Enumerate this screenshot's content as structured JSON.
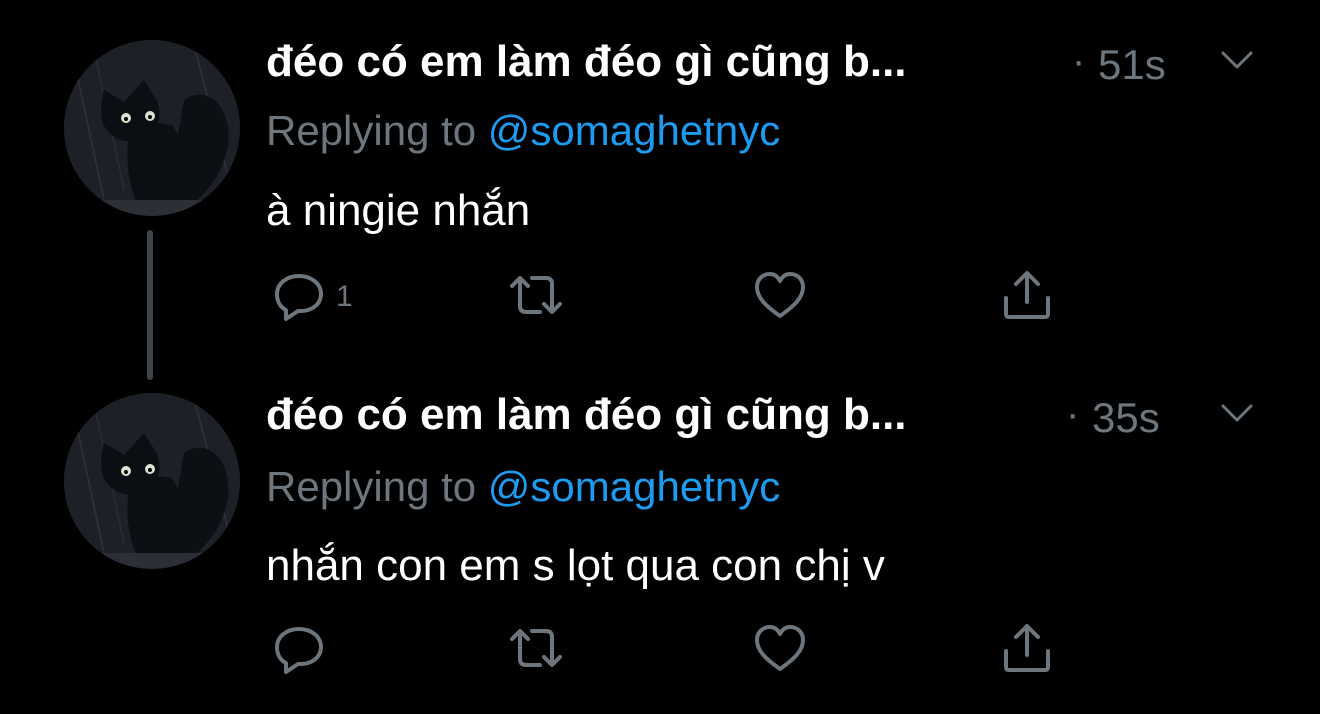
{
  "thread": {
    "tweets": [
      {
        "display_name": "đéo có em làm đéo gì cũng b...",
        "separator": "·",
        "time": "51s",
        "replying_prefix": "Replying to ",
        "replying_handle": "@somaghetnyc",
        "text": "à ningie nhắn",
        "reply_count": "1",
        "avatar_icon": "black-cat-avatar"
      },
      {
        "display_name": "đéo có em làm đéo gì cũng b...",
        "separator": "·",
        "time": "35s",
        "replying_prefix": "Replying to ",
        "replying_handle": "@somaghetnyc",
        "text": "nhắn con em s lọt qua con chị v",
        "reply_count": "",
        "avatar_icon": "black-cat-avatar"
      }
    ]
  },
  "icons": {
    "reply": "reply-icon",
    "retweet": "retweet-icon",
    "like": "heart-icon",
    "share": "share-icon",
    "more": "chevron-down-icon"
  },
  "colors": {
    "background": "#000000",
    "primary_text": "#ffffff",
    "secondary_text": "#6e767d",
    "link": "#1d9bf0",
    "thread_line": "#3d4348"
  }
}
